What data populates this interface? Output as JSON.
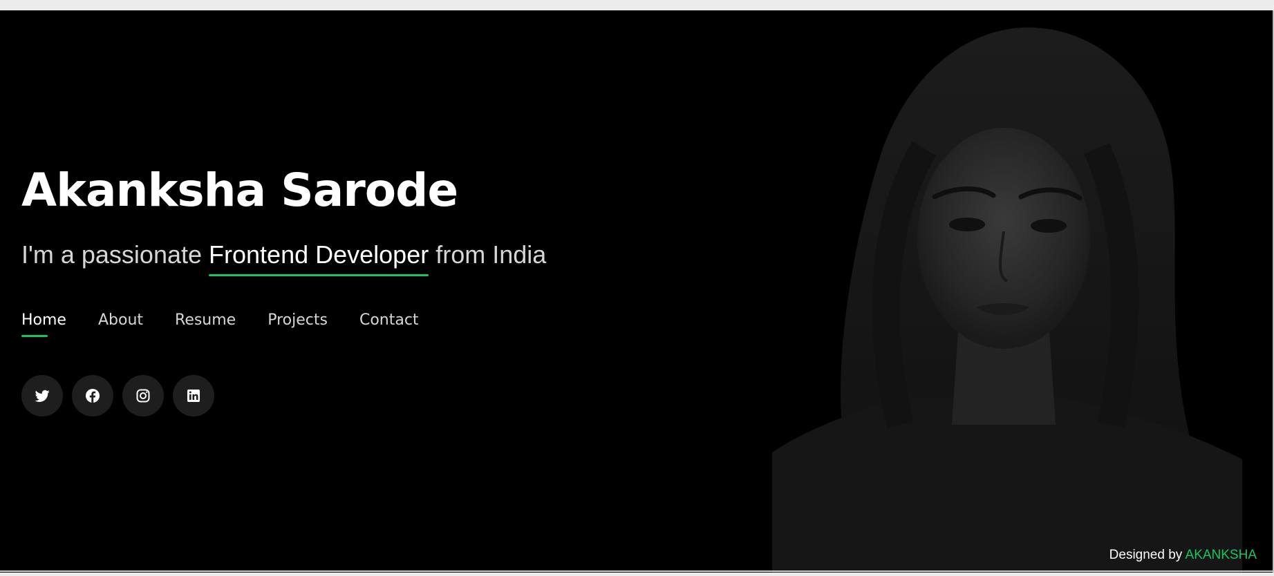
{
  "hero": {
    "name": "Akanksha Sarode",
    "tagline_before": "I'm a passionate ",
    "tagline_role": "Frontend Developer",
    "tagline_after": " from India"
  },
  "nav": {
    "items": [
      {
        "label": "Home",
        "active": true
      },
      {
        "label": "About",
        "active": false
      },
      {
        "label": "Resume",
        "active": false
      },
      {
        "label": "Projects",
        "active": false
      },
      {
        "label": "Contact",
        "active": false
      }
    ]
  },
  "socials": [
    {
      "icon": "twitter-icon"
    },
    {
      "icon": "facebook-icon"
    },
    {
      "icon": "instagram-icon"
    },
    {
      "icon": "linkedin-icon"
    }
  ],
  "footer": {
    "credit_prefix": "Designed by ",
    "credit_name": "AKANKSHA"
  },
  "colors": {
    "background": "#000000",
    "accent": "#18c461",
    "text": "#ffffff",
    "muted_text": "#d6d6d6",
    "social_bg": "#1e1e1e"
  }
}
